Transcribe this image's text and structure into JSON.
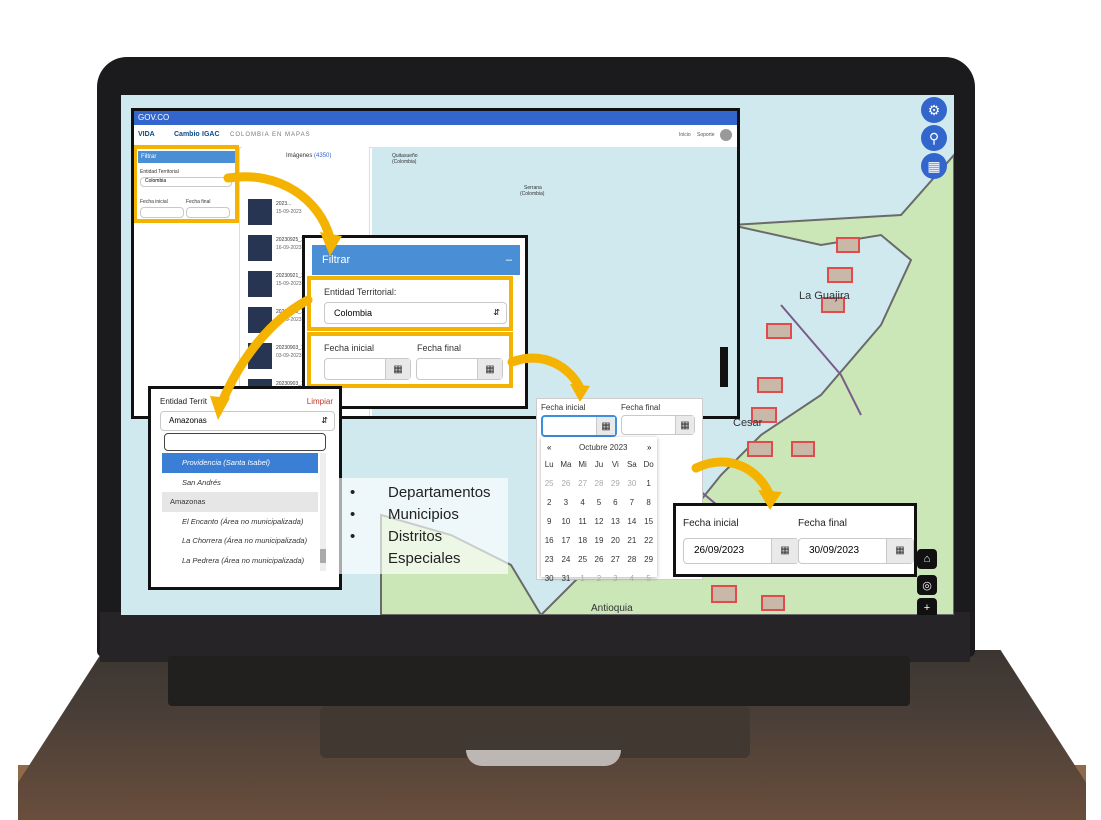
{
  "map": {
    "labels": {
      "la_guajira": "La Guajira",
      "cesar": "Cesar",
      "antioquia": "Antioquia",
      "quitasueno": "Quitasueño",
      "quitasueno_country": "(Colombia)",
      "serrana": "Serrana",
      "serrana_country": "(Colombia)"
    },
    "right_tools": {
      "tool1": "wrench-icon",
      "tool2": "map-pin-icon",
      "tool3": "layers-icon"
    },
    "bottom_tools": {
      "home": "home-icon",
      "locate": "locate-icon",
      "zoom_in": "+"
    }
  },
  "app": {
    "gov_label": "GOV.CO",
    "logos": {
      "logo1": "VIDA",
      "logo2": "Cambio",
      "logo3": "IGAC"
    },
    "title": "COLOMBIA EN MAPAS",
    "nav": {
      "inicio": "Inicio",
      "soporte": "Soporte"
    },
    "filter": {
      "header": "Filtrar",
      "entity_label": "Entidad Territorial",
      "entity_value": "Colombia",
      "start_label": "Fecha inicial",
      "end_label": "Fecha final"
    },
    "images": {
      "title": "Imágenes",
      "count": "(4350)",
      "items": [
        {
          "name": "2023...",
          "date": "15-09-2023"
        },
        {
          "name": "20230925_15...",
          "date": "16-09-2023"
        },
        {
          "name": "20230921_15...",
          "date": "15-09-2023"
        },
        {
          "name": "20230920_14...",
          "date": "07-09-2023"
        },
        {
          "name": "20230903_14...",
          "date": "03-09-2023"
        },
        {
          "name": "20230903_14...",
          "date": "03-09-2023"
        }
      ]
    }
  },
  "filter_zoom": {
    "header": "Filtrar",
    "collapse": "–",
    "entity_label": "Entidad Territorial:",
    "entity_value": "Colombia",
    "start_label": "Fecha inicial",
    "end_label": "Fecha final",
    "start_value": "",
    "end_value": ""
  },
  "dropdown_zoom": {
    "label": "Entidad Territ",
    "clear": "Limpiar",
    "selected": "Amazonas",
    "search_value": "",
    "options": [
      {
        "text": "Providencia (Santa Isabel)",
        "kind": "item",
        "active": true
      },
      {
        "text": "San Andrés",
        "kind": "item",
        "active": false
      },
      {
        "text": "Amazonas",
        "kind": "group",
        "active": false
      },
      {
        "text": "El Encanto (Área no municipalizada)",
        "kind": "item",
        "active": false
      },
      {
        "text": "La Chorrera (Área no municipalizada)",
        "kind": "item",
        "active": false
      },
      {
        "text": "La Pedrera (Área no municipalizada)",
        "kind": "item",
        "active": false
      }
    ]
  },
  "bullets": [
    "Departamentos",
    "Municipios",
    "Distritos",
    "Especiales"
  ],
  "calendar_zoom": {
    "start_label": "Fecha inicial",
    "end_label": "Fecha final",
    "prev": "«",
    "next": "»",
    "month": "Octubre 2023",
    "weekdays": [
      "Lu",
      "Ma",
      "Mi",
      "Ju",
      "Vi",
      "Sa",
      "Do"
    ],
    "weeks": [
      [
        "25",
        "26",
        "27",
        "28",
        "29",
        "30",
        "1"
      ],
      [
        "2",
        "3",
        "4",
        "5",
        "6",
        "7",
        "8"
      ],
      [
        "9",
        "10",
        "11",
        "12",
        "13",
        "14",
        "15"
      ],
      [
        "16",
        "17",
        "18",
        "19",
        "20",
        "21",
        "22"
      ],
      [
        "23",
        "24",
        "25",
        "26",
        "27",
        "28",
        "29"
      ],
      [
        "30",
        "31",
        "1",
        "2",
        "3",
        "4",
        "5"
      ]
    ]
  },
  "dates_zoom": {
    "start_label": "Fecha inicial",
    "end_label": "Fecha final",
    "start_value": "26/09/2023",
    "end_value": "30/09/2023"
  },
  "colors": {
    "accent": "#f5b301",
    "app_blue": "#3366cc",
    "panel_blue": "#4a8fd6",
    "footprint": "#e04b4b"
  }
}
